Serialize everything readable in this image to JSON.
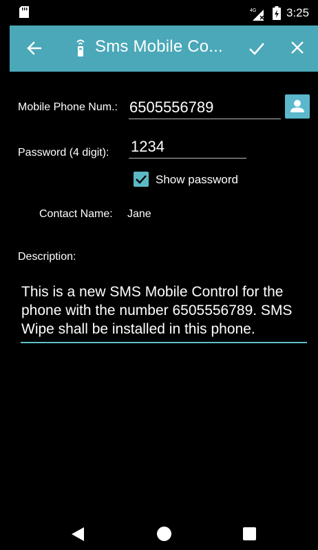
{
  "status_bar": {
    "time": "3:25",
    "network": "4G"
  },
  "app_bar": {
    "title": "Sms Mobile Co..."
  },
  "form": {
    "phone_label": "Mobile Phone Num.:",
    "phone_value": "6505556789",
    "password_label": "Password (4 digit):",
    "password_value": "1234",
    "show_password_label": "Show password",
    "show_password_checked": true,
    "contact_label": "Contact Name:",
    "contact_value": "Jane",
    "description_label": "Description:",
    "description_value": "This is a new SMS Mobile Control for the phone with the number 6505556789. SMS Wipe shall be installed in this phone."
  },
  "colors": {
    "accent": "#4aa8b8",
    "underline_active": "#5fc3c9",
    "background": "#000000"
  },
  "icons": {
    "back": "arrow-left-icon",
    "app": "remote-control-icon",
    "save": "check-icon",
    "close": "close-icon",
    "contact": "person-icon"
  }
}
